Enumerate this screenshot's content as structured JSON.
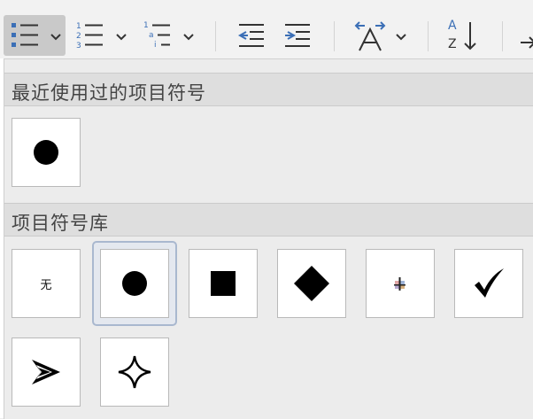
{
  "toolbar": {
    "buttons": [
      {
        "id": "bullets",
        "icon": "bulleted-list-icon",
        "active": true
      },
      {
        "id": "numbering",
        "icon": "numbered-list-icon"
      },
      {
        "id": "multilevel",
        "icon": "multilevel-list-icon"
      },
      {
        "id": "decrease-indent",
        "icon": "decrease-indent-icon"
      },
      {
        "id": "increase-indent",
        "icon": "increase-indent-icon"
      },
      {
        "id": "text-direction",
        "icon": "text-direction-icon"
      },
      {
        "id": "sort",
        "icon": "sort-az-icon"
      }
    ],
    "numbering_glyphs": [
      "1",
      "2",
      "3"
    ],
    "multilevel_glyphs": [
      "1",
      "a",
      "i"
    ],
    "sort_glyphs": [
      "A",
      "Z"
    ],
    "accent_color": "#3b6fb6"
  },
  "recent": {
    "title": "最近使用过的项目符号",
    "items": [
      {
        "name": "filled-circle",
        "icon": "filled-circle-icon"
      }
    ]
  },
  "library": {
    "title": "项目符号库",
    "items": [
      {
        "name": "none",
        "label": "无"
      },
      {
        "name": "filled-circle",
        "icon": "filled-circle-icon",
        "selected": true
      },
      {
        "name": "filled-square",
        "icon": "filled-square-icon"
      },
      {
        "name": "filled-diamond",
        "icon": "filled-diamond-icon"
      },
      {
        "name": "four-diamond",
        "icon": "four-diamond-icon"
      },
      {
        "name": "checkmark",
        "icon": "checkmark-icon"
      },
      {
        "name": "arrowhead",
        "icon": "arrowhead-icon"
      },
      {
        "name": "four-point-star",
        "icon": "four-point-star-icon"
      }
    ]
  }
}
